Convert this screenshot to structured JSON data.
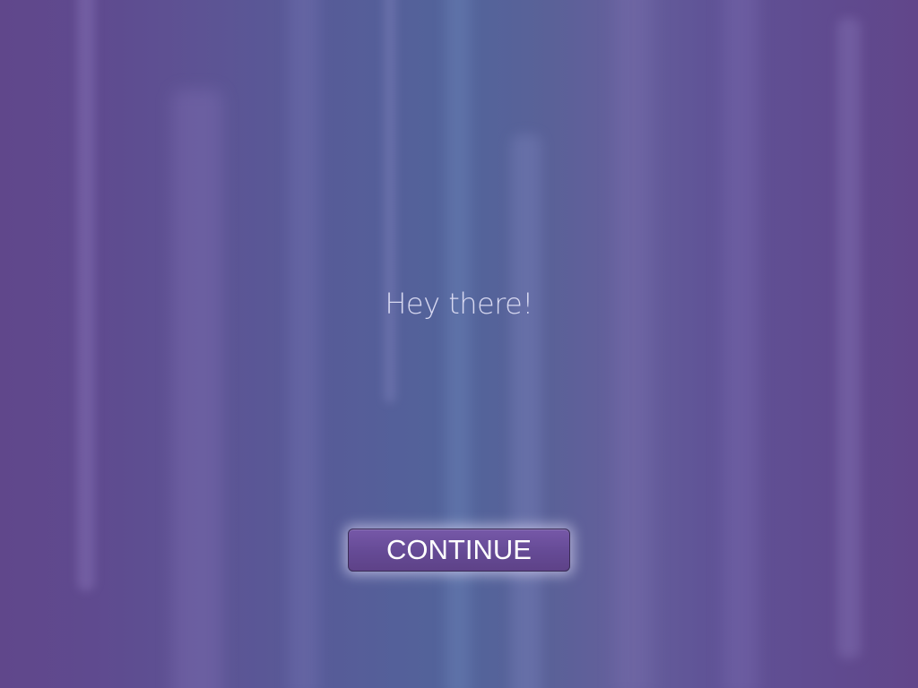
{
  "screen": {
    "greeting": "Hey there!",
    "continue_button": "CONTINUE"
  },
  "colors": {
    "background_left": "#60478b",
    "background_center": "#52649b",
    "background_right": "#61468a",
    "button_fill": "#654a95",
    "text": "#ffffff"
  }
}
